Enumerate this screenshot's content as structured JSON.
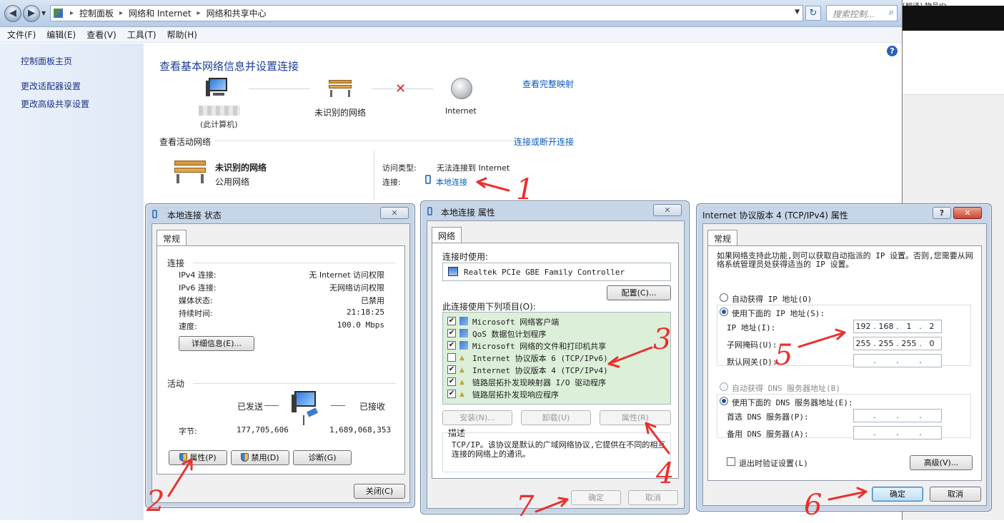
{
  "explorer": {
    "breadcrumb": [
      "控制面板",
      "网络和 Internet",
      "网络和共享中心"
    ],
    "search_placeholder": "搜索控制...",
    "menu": [
      "文件(F)",
      "编辑(E)",
      "查看(V)",
      "工具(T)",
      "帮助(H)"
    ],
    "sidebar": [
      "控制面板主页",
      "更改适配器设置",
      "更改高级共享设置"
    ],
    "title": "查看基本网络信息并设置连接",
    "map": {
      "computer_label": "(此计算机)",
      "network_label": "未识别的网络",
      "internet_label": "Internet",
      "full_map_link": "查看完整映射"
    },
    "active_networks_label": "查看活动网络",
    "connect_link": "连接或断开连接",
    "active": {
      "name": "未识别的网络",
      "type": "公用网络",
      "access_type_label": "访问类型:",
      "access_type_value": "无法连接到 Internet",
      "connection_label": "连接:",
      "connection_value": "本地连接"
    }
  },
  "strip": {
    "top_text": "[翻译]    物品ID"
  },
  "status_dialog": {
    "title": "本地连接 状态",
    "tab": "常规",
    "group_connection": "连接",
    "rows": [
      {
        "k": "IPv4 连接:",
        "v": "无 Internet 访问权限"
      },
      {
        "k": "IPv6 连接:",
        "v": "无网络访问权限"
      },
      {
        "k": "媒体状态:",
        "v": "已禁用"
      },
      {
        "k": "持续时间:",
        "v": "21:18:25"
      },
      {
        "k": "速度:",
        "v": "100.0 Mbps"
      }
    ],
    "details_btn": "详细信息(E)...",
    "group_activity": "活动",
    "sent_label": "已发送",
    "recv_label": "已接收",
    "bytes_label": "字节:",
    "bytes_sent": "177,705,606",
    "bytes_recv": "1,689,068,353",
    "properties_btn": "属性(P)",
    "disable_btn": "禁用(D)",
    "diagnose_btn": "诊断(G)",
    "close_btn": "关闭(C)"
  },
  "props_dialog": {
    "title": "本地连接 属性",
    "tab": "网络",
    "connect_using_label": "连接时使用:",
    "adapter": "Realtek PCIe GBE Family Controller",
    "configure_btn": "配置(C)...",
    "items_label": "此连接使用下列项目(O):",
    "items": [
      {
        "label": "Microsoft 网络客户端",
        "checked": true
      },
      {
        "label": "QoS 数据包计划程序",
        "checked": true
      },
      {
        "label": "Microsoft 网络的文件和打印机共享",
        "checked": true
      },
      {
        "label": "Internet 协议版本 6 (TCP/IPv6)",
        "checked": false
      },
      {
        "label": "Internet 协议版本 4 (TCP/IPv4)",
        "checked": true
      },
      {
        "label": "链路层拓扑发现映射器 I/O 驱动程序",
        "checked": true
      },
      {
        "label": "链路层拓扑发现响应程序",
        "checked": true
      }
    ],
    "install_btn": "安装(N)...",
    "uninstall_btn": "卸载(U)",
    "properties_btn": "属性(R)",
    "desc_label": "描述",
    "desc_text": "TCP/IP。该协议是默认的广域网络协议,它提供在不同的相互连接的网络上的通讯。",
    "ok_btn": "确定",
    "cancel_btn": "取消"
  },
  "ipv4_dialog": {
    "title": "Internet 协议版本 4 (TCP/IPv4) 属性",
    "tab": "常规",
    "intro": "如果网络支持此功能,则可以获取自动指派的 IP 设置。否则,您需要从网络系统管理员处获得适当的 IP 设置。",
    "auto_ip": "自动获得 IP 地址(O)",
    "use_ip": "使用下面的 IP 地址(S):",
    "ip_label": "IP 地址(I):",
    "ip_value": [
      "192",
      "168",
      "1",
      "2"
    ],
    "mask_label": "子网掩码(U):",
    "mask_value": [
      "255",
      "255",
      "255",
      "0"
    ],
    "gateway_label": "默认网关(D):",
    "auto_dns": "自动获得 DNS 服务器地址(B)",
    "use_dns": "使用下面的 DNS 服务器地址(E):",
    "pref_dns_label": "首选 DNS 服务器(P):",
    "alt_dns_label": "备用 DNS 服务器(A):",
    "validate_label": "退出时验证设置(L)",
    "advanced_btn": "高级(V)...",
    "ok_btn": "确定",
    "cancel_btn": "取消"
  },
  "annotations": [
    "1",
    "2",
    "3",
    "4",
    "5",
    "6",
    "7"
  ]
}
